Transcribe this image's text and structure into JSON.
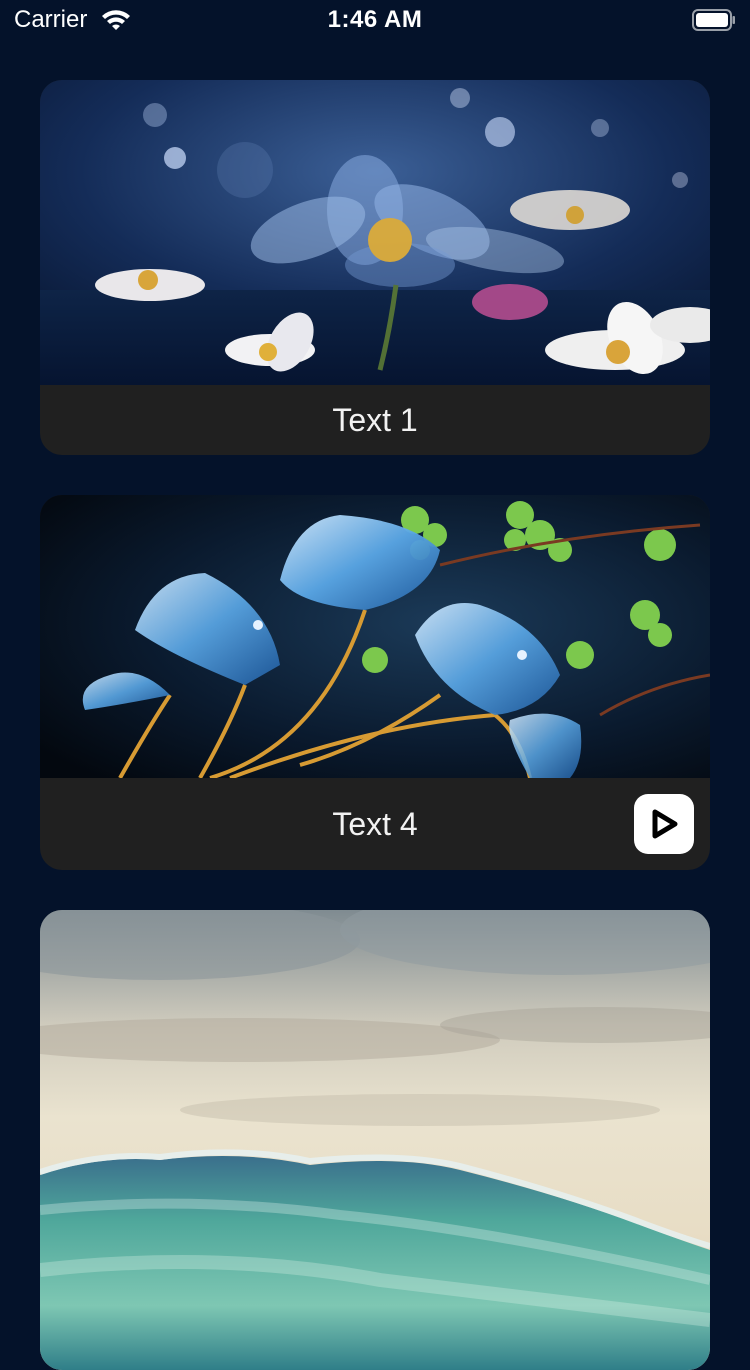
{
  "status_bar": {
    "carrier": "Carrier",
    "time": "1:46 AM",
    "icons": [
      "wifi-icon",
      "battery-icon"
    ]
  },
  "cards": [
    {
      "caption": "Text 1",
      "image": "blue-crystal-flower-on-water",
      "has_play_button": false
    },
    {
      "caption": "Text 4",
      "image": "glass-ginkgo-leaves",
      "has_play_button": true,
      "play_icon": "play-icon"
    },
    {
      "caption": "",
      "image": "ocean-wave-at-dusk",
      "has_play_button": false
    }
  ],
  "colors": {
    "background": "#04122a",
    "card_footer": "#202020",
    "caption_text": "#f2f2f2",
    "play_button_bg": "#ffffff"
  }
}
